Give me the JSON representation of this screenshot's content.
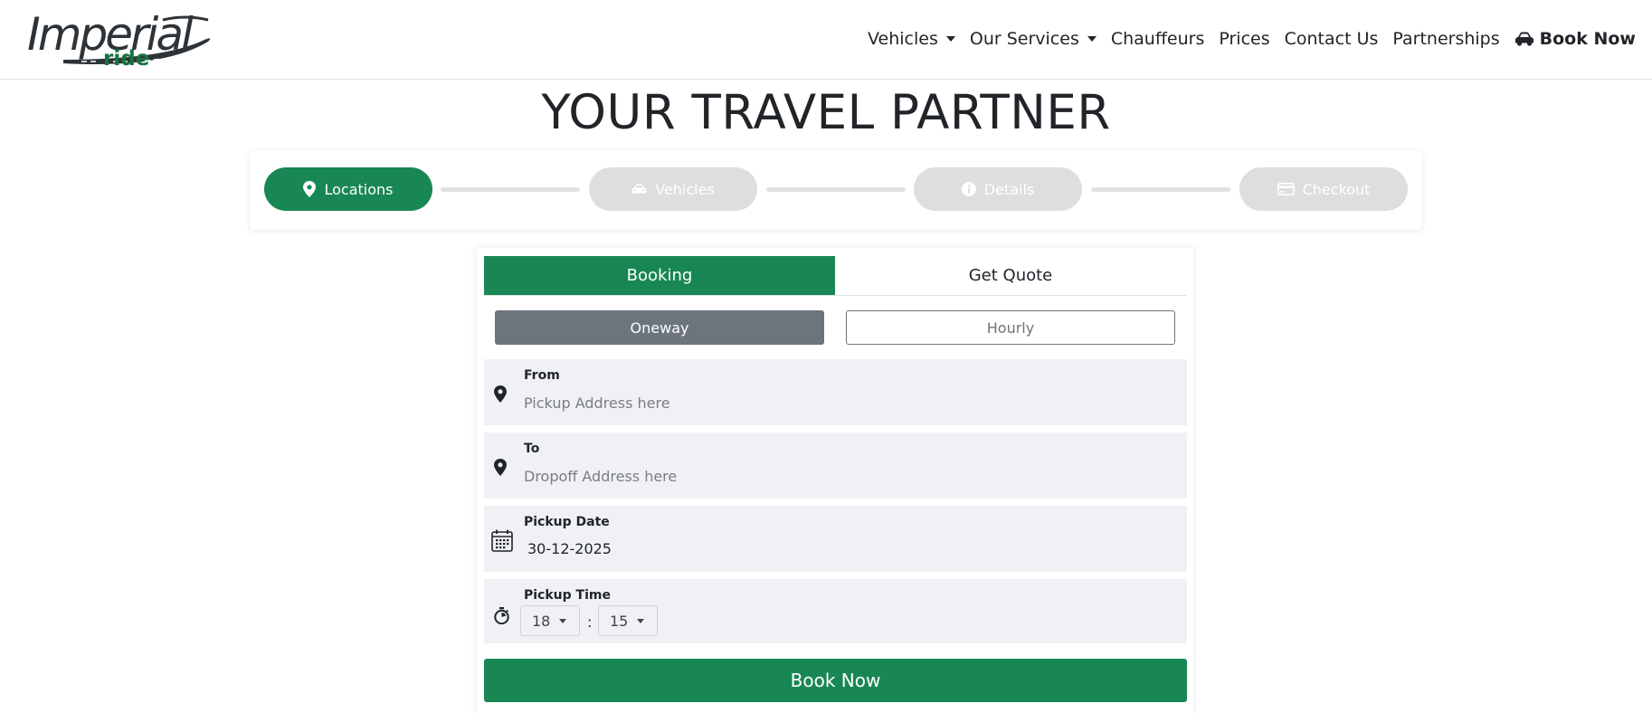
{
  "brand": {
    "logo_main": "Imperial",
    "logo_sub": "ride"
  },
  "nav": {
    "vehicles": "Vehicles",
    "services": "Our Services",
    "chauffeurs": "Chauffeurs",
    "prices": "Prices",
    "contact": "Contact Us",
    "partnerships": "Partnerships",
    "book_now": "Book Now"
  },
  "hero": {
    "title": "YOUR TRAVEL PARTNER"
  },
  "steps": [
    {
      "label": "Locations",
      "icon": "map-pin-icon",
      "active": true
    },
    {
      "label": "Vehicles",
      "icon": "car-icon",
      "active": false
    },
    {
      "label": "Details",
      "icon": "info-icon",
      "active": false
    },
    {
      "label": "Checkout",
      "icon": "credit-card-icon",
      "active": false
    }
  ],
  "tabs": {
    "booking": "Booking",
    "quote": "Get Quote",
    "active": "booking"
  },
  "trip_type": {
    "oneway": "Oneway",
    "hourly": "Hourly",
    "selected": "oneway"
  },
  "form": {
    "from_label": "From",
    "from_placeholder": "Pickup Address here",
    "from_value": "",
    "to_label": "To",
    "to_placeholder": "Dropoff Address here",
    "to_value": "",
    "date_label": "Pickup Date",
    "date_value": "30-12-2025",
    "time_label": "Pickup Time",
    "hour": "18",
    "separator": ":",
    "minute": "15"
  },
  "submit": {
    "label": "Book Now"
  },
  "colors": {
    "primary": "#198754",
    "secondary": "#6c757d",
    "field_bg": "#f0f1f5",
    "step_inactive": "#dedede"
  }
}
